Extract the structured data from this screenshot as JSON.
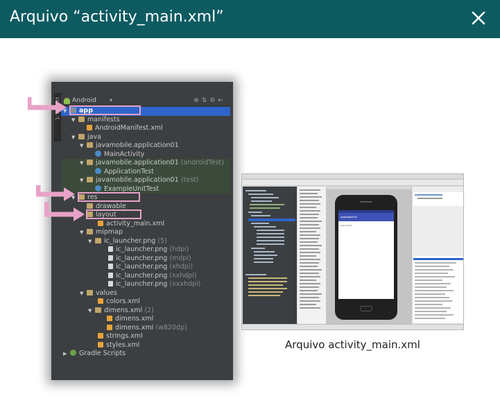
{
  "modal": {
    "title": "Arquivo “activity_main.xml”",
    "close_icon": "close-icon"
  },
  "project_tree": {
    "view_label": "Android",
    "side_tab_label": "1: Project",
    "rows": [
      {
        "label": "app",
        "suffix": "",
        "icon": "module-folder-icon"
      },
      {
        "label": "manifests",
        "suffix": "",
        "icon": "folder-icon"
      },
      {
        "label": "AndroidManifest.xml",
        "suffix": "",
        "icon": "xml-file-icon"
      },
      {
        "label": "java",
        "suffix": "",
        "icon": "folder-icon"
      },
      {
        "label": "javamobile.application01",
        "suffix": "",
        "icon": "package-icon"
      },
      {
        "label": "MainActivity",
        "suffix": "",
        "icon": "class-icon"
      },
      {
        "label": "javamobile.application01",
        "suffix": "(androidTest)",
        "icon": "package-icon"
      },
      {
        "label": "ApplicationTest",
        "suffix": "",
        "icon": "class-icon"
      },
      {
        "label": "javamobile.application01",
        "suffix": "(test)",
        "icon": "package-icon"
      },
      {
        "label": "ExampleUnitTest",
        "suffix": "",
        "icon": "class-icon"
      },
      {
        "label": "res",
        "suffix": "",
        "icon": "folder-icon"
      },
      {
        "label": "drawable",
        "suffix": "",
        "icon": "folder-icon"
      },
      {
        "label": "layout",
        "suffix": "",
        "icon": "folder-icon"
      },
      {
        "label": "activity_main.xml",
        "suffix": "",
        "icon": "xml-file-icon"
      },
      {
        "label": "mipmap",
        "suffix": "",
        "icon": "folder-icon"
      },
      {
        "label": "ic_launcher.png",
        "suffix": "(5)",
        "icon": "folder-icon"
      },
      {
        "label": "ic_launcher.png",
        "suffix": "(hdpi)",
        "icon": "image-file-icon"
      },
      {
        "label": "ic_launcher.png",
        "suffix": "(mdpi)",
        "icon": "image-file-icon"
      },
      {
        "label": "ic_launcher.png",
        "suffix": "(xhdpi)",
        "icon": "image-file-icon"
      },
      {
        "label": "ic_launcher.png",
        "suffix": "(xxhdpi)",
        "icon": "image-file-icon"
      },
      {
        "label": "ic_launcher.png",
        "suffix": "(xxxhdpi)",
        "icon": "image-file-icon"
      },
      {
        "label": "values",
        "suffix": "",
        "icon": "folder-icon"
      },
      {
        "label": "colors.xml",
        "suffix": "",
        "icon": "xml-file-icon"
      },
      {
        "label": "dimens.xml",
        "suffix": "(2)",
        "icon": "folder-icon"
      },
      {
        "label": "dimens.xml",
        "suffix": "",
        "icon": "xml-file-icon"
      },
      {
        "label": "dimens.xml",
        "suffix": "(w820dp)",
        "icon": "xml-file-icon"
      },
      {
        "label": "strings.xml",
        "suffix": "",
        "icon": "xml-file-icon"
      },
      {
        "label": "styles.xml",
        "suffix": "",
        "icon": "xml-file-icon"
      },
      {
        "label": "Gradle Scripts",
        "suffix": "",
        "icon": "gradle-icon"
      }
    ]
  },
  "ide_preview": {
    "app_bar_title": "Application01",
    "content_text": "Hello World!"
  },
  "caption": "Arquivo activity_main.xml",
  "colors": {
    "header_bg": "#0d5b61",
    "highlight_pink": "#e8a2c8",
    "selection_blue": "#2f65ca"
  }
}
